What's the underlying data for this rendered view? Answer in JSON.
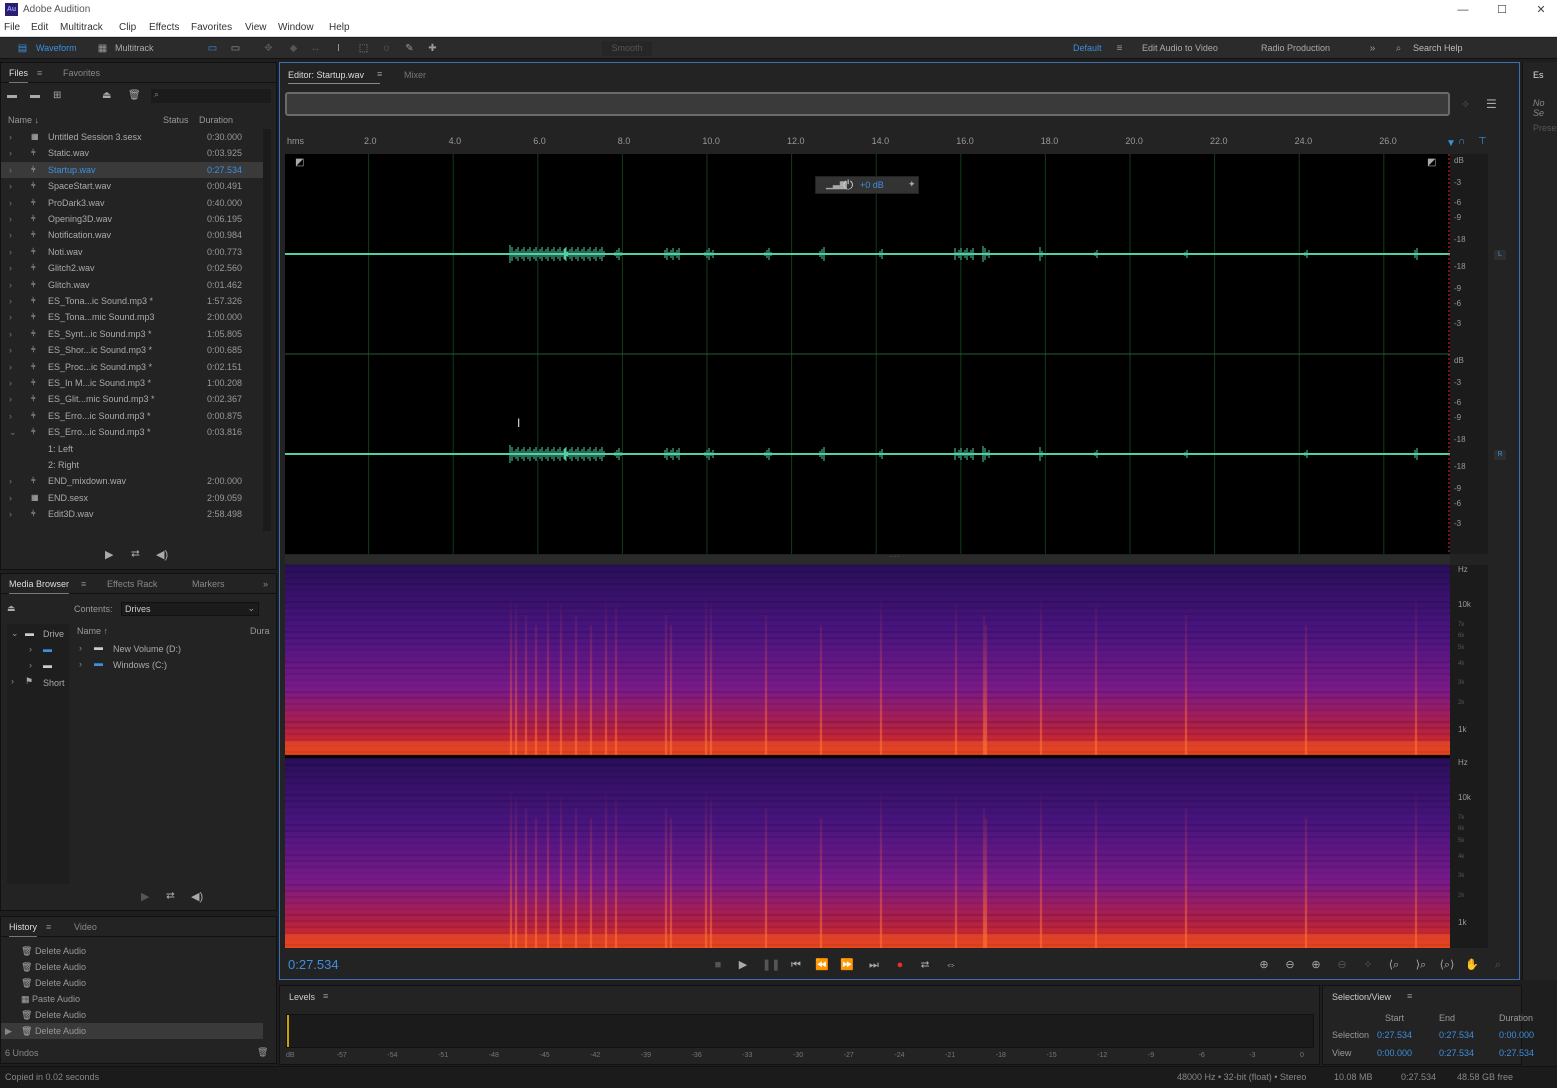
{
  "window": {
    "title": "Adobe Audition",
    "logo_text": "Au"
  },
  "menu": [
    "File",
    "Edit",
    "Multitrack",
    "Clip",
    "Effects",
    "Favorites",
    "View",
    "Window",
    "Help"
  ],
  "toolbar": {
    "waveform_label": "Waveform",
    "multitrack_label": "Multitrack",
    "smooth_label": "Smooth",
    "workspace_default": "Default",
    "workspace_edit_audio": "Edit Audio to Video",
    "workspace_radio": "Radio Production",
    "search_help": "Search Help"
  },
  "files_panel": {
    "tabs": [
      "Files",
      "Favorites"
    ],
    "col_name": "Name",
    "col_status": "Status",
    "col_duration": "Duration",
    "files": [
      {
        "name": "Untitled Session 3.sesx",
        "duration": "0:30.000",
        "type": "session"
      },
      {
        "name": "Static.wav",
        "duration": "0:03.925",
        "type": "audio"
      },
      {
        "name": "Startup.wav",
        "duration": "0:27.534",
        "type": "audio",
        "selected": true
      },
      {
        "name": "SpaceStart.wav",
        "duration": "0:00.491",
        "type": "audio"
      },
      {
        "name": "ProDark3.wav",
        "duration": "0:40.000",
        "type": "audio"
      },
      {
        "name": "Opening3D.wav",
        "duration": "0:06.195",
        "type": "audio"
      },
      {
        "name": "Notification.wav",
        "duration": "0:00.984",
        "type": "audio"
      },
      {
        "name": "Noti.wav",
        "duration": "0:00.773",
        "type": "audio"
      },
      {
        "name": "Glitch2.wav",
        "duration": "0:02.560",
        "type": "audio"
      },
      {
        "name": "Glitch.wav",
        "duration": "0:01.462",
        "type": "audio"
      },
      {
        "name": "ES_Tona...ic Sound.mp3 *",
        "duration": "1:57.326",
        "type": "audio"
      },
      {
        "name": "ES_Tona...mic Sound.mp3",
        "duration": "2:00.000",
        "type": "audio"
      },
      {
        "name": "ES_Synt...ic Sound.mp3 *",
        "duration": "1:05.805",
        "type": "audio"
      },
      {
        "name": "ES_Shor...ic Sound.mp3 *",
        "duration": "0:00.685",
        "type": "audio"
      },
      {
        "name": "ES_Proc...ic Sound.mp3 *",
        "duration": "0:02.151",
        "type": "audio"
      },
      {
        "name": "ES_In M...ic Sound.mp3 *",
        "duration": "1:00.208",
        "type": "audio"
      },
      {
        "name": "ES_Glit...mic Sound.mp3 *",
        "duration": "0:02.367",
        "type": "audio"
      },
      {
        "name": "ES_Erro...ic Sound.mp3 *",
        "duration": "0:00.875",
        "type": "audio"
      },
      {
        "name": "ES_Erro...ic Sound.mp3 *",
        "duration": "0:03.816",
        "type": "audio",
        "expanded": true
      },
      {
        "name": "1: Left",
        "duration": "",
        "type": "channel"
      },
      {
        "name": "2: Right",
        "duration": "",
        "type": "channel"
      },
      {
        "name": "END_mixdown.wav",
        "duration": "2:00.000",
        "type": "audio"
      },
      {
        "name": "END.sesx",
        "duration": "2:09.059",
        "type": "session"
      },
      {
        "name": "Edit3D.wav",
        "duration": "2:58.498",
        "type": "audio"
      }
    ]
  },
  "media_browser": {
    "tabs": [
      "Media Browser",
      "Effects Rack",
      "Markers"
    ],
    "contents_label": "Contents:",
    "contents_value": "Drives",
    "tree": [
      "Drive",
      "Short"
    ],
    "col_name": "Name",
    "col_duration": "Dura",
    "items": [
      "New Volume (D:)",
      "Windows (C:)"
    ]
  },
  "history": {
    "tabs": [
      "History",
      "Video"
    ],
    "items": [
      "Delete Audio",
      "Delete Audio",
      "Delete Audio",
      "Paste Audio",
      "Delete Audio",
      "Delete Audio"
    ],
    "undo_count": "6 Undos"
  },
  "editor": {
    "tab_label": "Editor: Startup.wav",
    "mixer_label": "Mixer",
    "ruler_unit": "hms",
    "ruler_ticks": [
      "2.0",
      "4.0",
      "6.0",
      "8.0",
      "10.0",
      "12.0",
      "14.0",
      "16.0",
      "18.0",
      "20.0",
      "22.0",
      "24.0",
      "26.0"
    ],
    "hud_gain": "+0 dB",
    "db_labels": [
      "dB",
      "-3",
      "-6",
      "-9",
      "-18",
      "-18",
      "-9",
      "-6",
      "-3"
    ],
    "channel_left": "L",
    "channel_right": "R",
    "hz_labels": [
      "Hz",
      "10k",
      "7k",
      "6k",
      "5k",
      "4k",
      "3k",
      "2k",
      "1k"
    ],
    "timecode": "0:27.534"
  },
  "levels": {
    "title": "Levels",
    "scale": [
      "dB",
      "-57",
      "-54",
      "-51",
      "-48",
      "-45",
      "-42",
      "-39",
      "-36",
      "-33",
      "-30",
      "-27",
      "-24",
      "-21",
      "-18",
      "-15",
      "-12",
      "-9",
      "-6",
      "-3",
      "0"
    ]
  },
  "selection_view": {
    "title": "Selection/View",
    "col_start": "Start",
    "col_end": "End",
    "col_duration": "Duration",
    "selection_label": "Selection",
    "selection_start": "0:27.534",
    "selection_end": "0:27.534",
    "selection_duration": "0:00.000",
    "view_label": "View",
    "view_start": "0:00.000",
    "view_end": "0:27.534",
    "view_duration": "0:27.534"
  },
  "right_panel": {
    "tab": "Es",
    "text": "No Se",
    "text2": "Prese"
  },
  "status": {
    "left": "Copied in 0.02 seconds",
    "format": "48000 Hz • 32-bit (float) • Stereo",
    "size": "10.08 MB",
    "duration": "0:27.534",
    "free": "48.58 GB free"
  },
  "colors": {
    "accent": "#3d8fe0",
    "waveform": "#4fd1a3"
  }
}
